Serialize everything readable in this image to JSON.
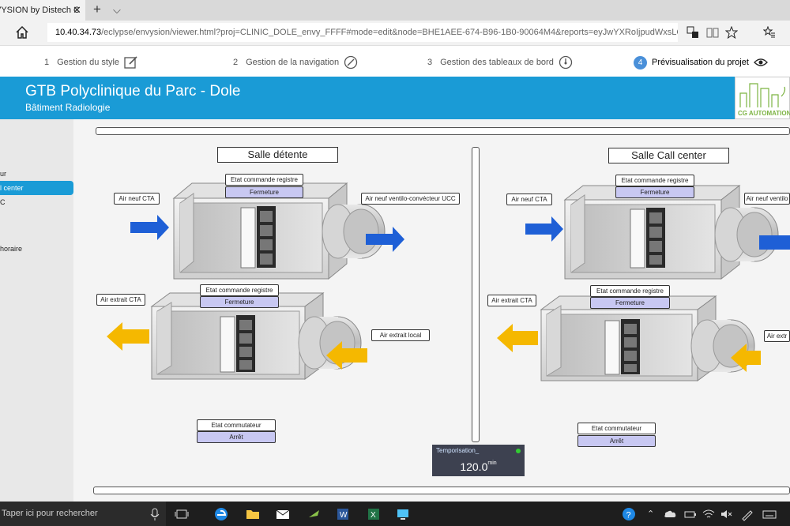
{
  "browser": {
    "tab_title": "VYSION by Distech C",
    "new_tab_symbol": "+",
    "tab_list_symbol": "⌵",
    "close_symbol": "✕",
    "url_host": "10.40.34.73",
    "url_path": "/eclypse/envysion/viewer.html?proj=CLINIC_DOLE_envy_FFFF#mode=edit&node=BHE1AEE-674-B96-1B0-90064M4&reports=eyJwYXRoIjpudWxsLCJwYWdlIjpudWxsLC"
  },
  "steps": [
    {
      "num": "1",
      "label": "Gestion du style",
      "icon": "edit-icon"
    },
    {
      "num": "2",
      "label": "Gestion de la navigation",
      "icon": "compass-icon"
    },
    {
      "num": "3",
      "label": "Gestion des tableaux de bord",
      "icon": "dashboard-icon"
    },
    {
      "num": "4",
      "label": "Prévisualisation du projet",
      "icon": "eye-icon"
    }
  ],
  "header": {
    "title": "GTB Polyclinique du Parc - Dole",
    "subtitle": "Bâtiment Radiologie",
    "logo_text": "CG AUTOMATION"
  },
  "sidebar": {
    "items": [
      {
        "label": "ur"
      },
      {
        "label": "l center"
      },
      {
        "label": "C"
      },
      {
        "label": "horaire"
      }
    ]
  },
  "left": {
    "title": "Salle détente",
    "registre1_label": "Etat commande registre",
    "registre1_value": "Fermeture",
    "air_neuf_cta": "Air neuf CTA",
    "air_neuf_ucc": "Air neuf ventilo-convécteur UCC",
    "registre2_label": "Etat commande registre",
    "registre2_value": "Fermeture",
    "air_extrait_cta": "Air extrait CTA",
    "air_extrait_local": "Air extrait local",
    "commutateur_label": "Etat commutateur",
    "commutateur_value": "Arrêt"
  },
  "right": {
    "title": "Salle Call center",
    "registre1_label": "Etat commande registre",
    "registre1_value": "Fermeture",
    "air_neuf_cta": "Air neuf CTA",
    "air_neuf_ucc": "Air neuf ventilo",
    "registre2_label": "Etat commande registre",
    "registre2_value": "Fermeture",
    "air_extrait_cta": "Air extrait CTA",
    "air_extrait_local": "Air extr",
    "commutateur_label": "Etat commutateur",
    "commutateur_value": "Arrêt"
  },
  "tempo": {
    "label": "Temporisation_",
    "value": "120.0",
    "unit": "min"
  },
  "taskbar": {
    "search_placeholder": "Taper ici pour rechercher"
  },
  "colors": {
    "header_blue": "#1a9bd6",
    "arrow_blue": "#1e5fd6",
    "arrow_yellow": "#f5b800",
    "value_bg": "#c8c8f2"
  }
}
